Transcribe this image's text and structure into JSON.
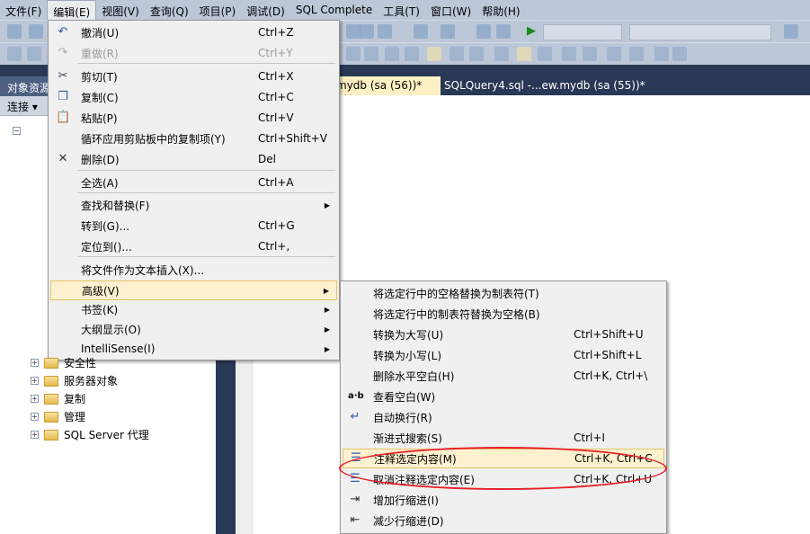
{
  "menubar": [
    "文件(F)",
    "编辑(E)",
    "视图(V)",
    "查询(Q)",
    "项目(P)",
    "调试(D)",
    "SQL Complete",
    "工具(T)",
    "窗口(W)",
    "帮助(H)"
  ],
  "object_explorer": {
    "title": "对象资源",
    "connect": "连接",
    "tree": [
      "安全性",
      "服务器对象",
      "复制",
      "管理",
      "SQL Server 代理"
    ]
  },
  "tabs": [
    {
      "label": "mydb (sa (56))*",
      "active": true
    },
    {
      "label": "SQLQuery4.sql -...ew.mydb (sa (55))*",
      "active": false
    }
  ],
  "edit_menu": [
    {
      "label": "撤消(U)",
      "shortcut": "Ctrl+Z",
      "icon": "undo-icon"
    },
    {
      "label": "重做(R)",
      "shortcut": "Ctrl+Y",
      "icon": "redo-icon",
      "disabled": true
    },
    {
      "label": "剪切(T)",
      "shortcut": "Ctrl+X",
      "icon": "cut-icon"
    },
    {
      "label": "复制(C)",
      "shortcut": "Ctrl+C",
      "icon": "copy-icon"
    },
    {
      "label": "粘贴(P)",
      "shortcut": "Ctrl+V",
      "icon": "paste-icon"
    },
    {
      "label": "循环应用剪贴板中的复制项(Y)",
      "shortcut": "Ctrl+Shift+V"
    },
    {
      "label": "删除(D)",
      "shortcut": "Del",
      "icon": "delete-icon"
    },
    {
      "label": "全选(A)",
      "shortcut": "Ctrl+A"
    },
    {
      "label": "查找和替换(F)",
      "shortcut": "",
      "submenu": true
    },
    {
      "label": "转到(G)...",
      "shortcut": "Ctrl+G"
    },
    {
      "label": "定位到()...",
      "shortcut": "Ctrl+,"
    },
    {
      "label": "将文件作为文本插入(X)...",
      "shortcut": ""
    },
    {
      "label": "高级(V)",
      "shortcut": "",
      "submenu": true,
      "highlighted": true
    },
    {
      "label": "书签(K)",
      "shortcut": "",
      "submenu": true
    },
    {
      "label": "大纲显示(O)",
      "shortcut": "",
      "submenu": true
    },
    {
      "label": "IntelliSense(I)",
      "shortcut": "",
      "submenu": true
    }
  ],
  "advanced_menu": [
    {
      "label": "将选定行中的空格替换为制表符(T)",
      "shortcut": ""
    },
    {
      "label": "将选定行中的制表符替换为空格(B)",
      "shortcut": ""
    },
    {
      "label": "转换为大写(U)",
      "shortcut": "Ctrl+Shift+U"
    },
    {
      "label": "转换为小写(L)",
      "shortcut": "Ctrl+Shift+L"
    },
    {
      "label": "删除水平空白(H)",
      "shortcut": "Ctrl+K, Ctrl+\\"
    },
    {
      "label": "查看空白(W)",
      "shortcut": "",
      "icon": "a·b"
    },
    {
      "label": "自动换行(R)",
      "shortcut": "",
      "icon": "word-wrap-icon"
    },
    {
      "label": "渐进式搜索(S)",
      "shortcut": "Ctrl+I"
    },
    {
      "label": "注释选定内容(M)",
      "shortcut": "Ctrl+K, Ctrl+C",
      "icon": "comment-icon",
      "highlighted": true
    },
    {
      "label": "取消注释选定内容(E)",
      "shortcut": "Ctrl+K, Ctrl+U",
      "icon": "uncomment-icon"
    },
    {
      "label": "增加行缩进(I)",
      "shortcut": "",
      "icon": "indent-icon"
    },
    {
      "label": "减少行缩进(D)",
      "shortcut": "",
      "icon": "outdent-icon"
    }
  ],
  "colors": {
    "highlight": "#fdf1cf",
    "annotation": "#e8202a"
  }
}
